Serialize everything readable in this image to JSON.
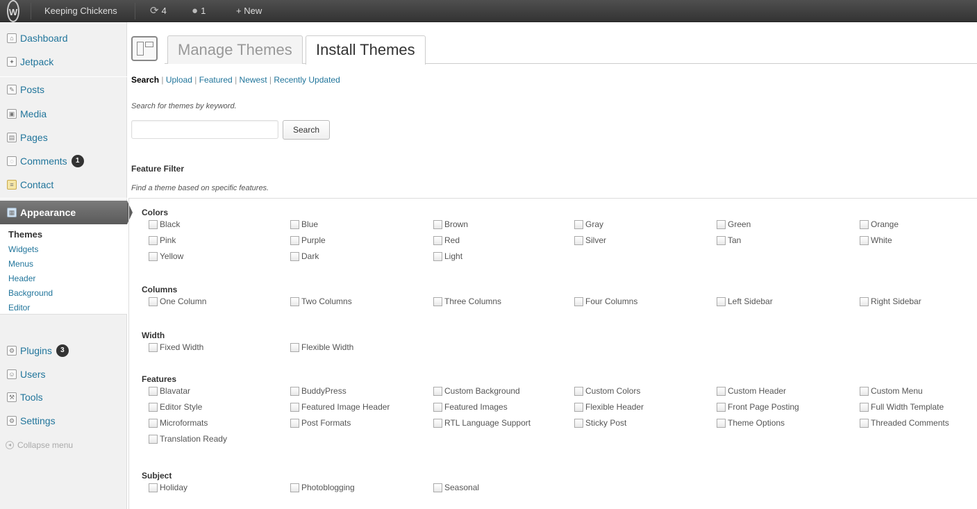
{
  "adminbar": {
    "site_name": "Keeping Chickens",
    "updates_count": "4",
    "comments_count": "1",
    "new_label": "+ New"
  },
  "sidebar": {
    "items": [
      {
        "label": "Dashboard",
        "icon": "dashboard-icon"
      },
      {
        "label": "Jetpack",
        "icon": "jetpack-icon"
      },
      {
        "label": "Posts",
        "icon": "posts-icon"
      },
      {
        "label": "Media",
        "icon": "media-icon"
      },
      {
        "label": "Pages",
        "icon": "pages-icon"
      },
      {
        "label": "Comments",
        "icon": "comments-icon",
        "badge": "1"
      },
      {
        "label": "Contact",
        "icon": "contact-icon"
      },
      {
        "label": "Appearance",
        "icon": "appearance-icon"
      },
      {
        "label": "Plugins",
        "icon": "plugins-icon",
        "badge": "3"
      },
      {
        "label": "Users",
        "icon": "users-icon"
      },
      {
        "label": "Tools",
        "icon": "tools-icon"
      },
      {
        "label": "Settings",
        "icon": "settings-icon"
      }
    ],
    "appearance_submenu": [
      "Themes",
      "Widgets",
      "Menus",
      "Header",
      "Background",
      "Editor"
    ],
    "collapse_label": "Collapse menu"
  },
  "tabs": {
    "manage": "Manage Themes",
    "install": "Install Themes"
  },
  "subnav": {
    "search": "Search",
    "upload": "Upload",
    "featured": "Featured",
    "newest": "Newest",
    "recently_updated": "Recently Updated",
    "separator": "|"
  },
  "search": {
    "hint": "Search for themes by keyword.",
    "value": "",
    "button_label": "Search"
  },
  "feature_filter": {
    "title": "Feature Filter",
    "hint": "Find a theme based on specific features.",
    "groups": [
      {
        "title": "Colors",
        "options": [
          "Black",
          "Blue",
          "Brown",
          "Gray",
          "Green",
          "Orange",
          "Pink",
          "Purple",
          "Red",
          "Silver",
          "Tan",
          "White",
          "Yellow",
          "Dark",
          "Light"
        ]
      },
      {
        "title": "Columns",
        "options": [
          "One Column",
          "Two Columns",
          "Three Columns",
          "Four Columns",
          "Left Sidebar",
          "Right Sidebar"
        ]
      },
      {
        "title": "Width",
        "options": [
          "Fixed Width",
          "Flexible Width"
        ]
      },
      {
        "title": "Features",
        "options": [
          "Blavatar",
          "BuddyPress",
          "Custom Background",
          "Custom Colors",
          "Custom Header",
          "Custom Menu",
          "Editor Style",
          "Featured Image Header",
          "Featured Images",
          "Flexible Header",
          "Front Page Posting",
          "Full Width Template",
          "Microformats",
          "Post Formats",
          "RTL Language Support",
          "Sticky Post",
          "Theme Options",
          "Threaded Comments",
          "Translation Ready"
        ]
      },
      {
        "title": "Subject",
        "options": [
          "Holiday",
          "Photoblogging",
          "Seasonal"
        ]
      }
    ]
  },
  "colors": {
    "adminbar_bg": "#464646",
    "link": "#21759b",
    "active_menu_bg": "#666666"
  }
}
